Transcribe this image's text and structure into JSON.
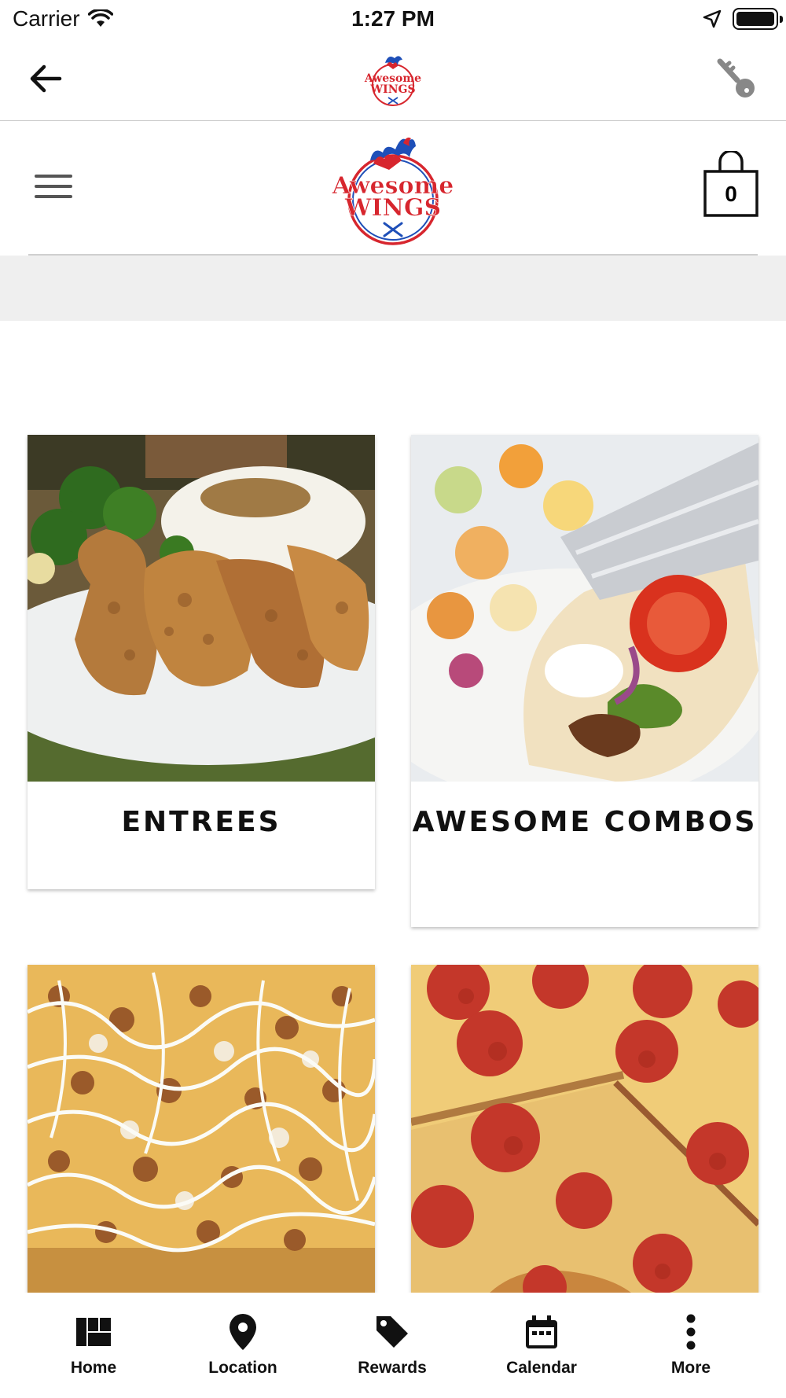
{
  "status_bar": {
    "carrier": "Carrier",
    "time": "1:27 PM",
    "icons": [
      "wifi-icon",
      "location-arrow-icon",
      "battery-icon"
    ]
  },
  "nav_bar": {
    "back_icon": "arrow-left-icon",
    "logo_text": [
      "Awesome",
      "WINGS"
    ],
    "key_icon": "key-icon"
  },
  "header": {
    "menu_icon": "hamburger-icon",
    "logo_text": [
      "Awesome",
      "WINGS"
    ],
    "cart_count": "0",
    "cart_icon": "shopping-bag-icon"
  },
  "categories": [
    {
      "title": "ENTREES",
      "image": "fried chicken tenders with mashed potatoes and broccoli"
    },
    {
      "title": "AWESOME COMBOS",
      "image": "gyro wrap with tomato and salad"
    },
    {
      "title": "",
      "image": "chicken bacon ranch pizza"
    },
    {
      "title": "",
      "image": "pepperoni pizza"
    }
  ],
  "tab_bar": {
    "tabs": [
      {
        "label": "Home",
        "icon": "grid-icon"
      },
      {
        "label": "Location",
        "icon": "map-pin-icon"
      },
      {
        "label": "Rewards",
        "icon": "tag-icon"
      },
      {
        "label": "Calendar",
        "icon": "calendar-icon"
      },
      {
        "label": "More",
        "icon": "more-vertical-icon"
      }
    ]
  },
  "colors": {
    "brand_red": "#d7262e",
    "brand_blue": "#1e4fb8",
    "band_gray": "#efefef",
    "text": "#111111"
  }
}
